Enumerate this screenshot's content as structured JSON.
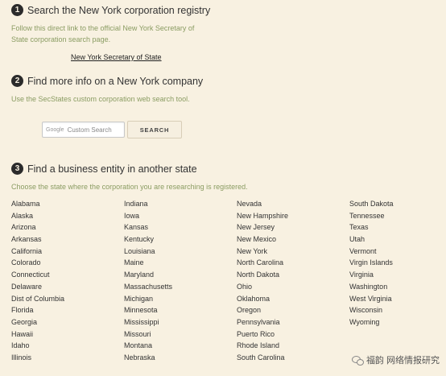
{
  "step1": {
    "num": "1",
    "title": "Search the New York corporation registry",
    "desc_line1": "Follow this direct link to the official New York Secretary of",
    "desc_line2": "State corporation search page.",
    "link": "New York Secretary of State"
  },
  "step2": {
    "num": "2",
    "title": "Find more info on a New York company",
    "desc": "Use the SecStates custom corporation web search tool.",
    "search_google": "Google",
    "search_placeholder": "Custom Search",
    "search_button": "SEARCH"
  },
  "step3": {
    "num": "3",
    "title": "Find a business entity in another state",
    "desc": "Choose the state where the corporation you are researching is registered."
  },
  "states": [
    [
      "Alabama",
      "Alaska",
      "Arizona",
      "Arkansas",
      "California",
      "Colorado",
      "Connecticut",
      "Delaware",
      "Dist of Columbia",
      "Florida",
      "Georgia",
      "Hawaii",
      "Idaho",
      "Illinois"
    ],
    [
      "Indiana",
      "Iowa",
      "Kansas",
      "Kentucky",
      "Louisiana",
      "Maine",
      "Maryland",
      "Massachusetts",
      "Michigan",
      "Minnesota",
      "Mississippi",
      "Missouri",
      "Montana",
      "Nebraska"
    ],
    [
      "Nevada",
      "New Hampshire",
      "New Jersey",
      "New Mexico",
      "New York",
      "North Carolina",
      "North Dakota",
      "Ohio",
      "Oklahoma",
      "Oregon",
      "Pennsylvania",
      "Puerto Rico",
      "Rhode Island",
      "South Carolina"
    ],
    [
      "South Dakota",
      "Tennessee",
      "Texas",
      "Utah",
      "Vermont",
      "Virgin Islands",
      "Virginia",
      "Washington",
      "West Virginia",
      "Wisconsin",
      "Wyoming"
    ]
  ],
  "watermark": "福韵 网络情报研究",
  "colors": {
    "background": "#f8f1e1",
    "desc_text": "#8a9c62",
    "badge": "#2b2b2b"
  }
}
